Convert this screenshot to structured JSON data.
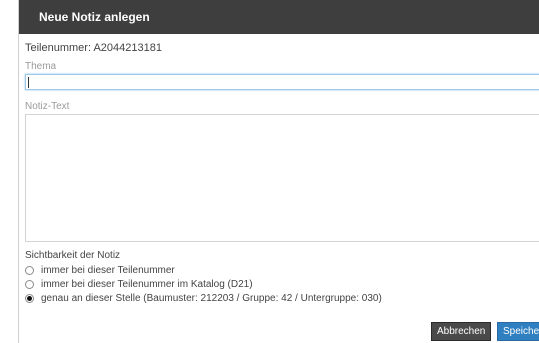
{
  "dialog": {
    "title": "Neue Notiz anlegen",
    "part_number": "Teilenummer: A2044213181",
    "thema_label": "Thema",
    "thema_value": "",
    "notiz_label": "Notiz-Text",
    "notiz_value": "",
    "visibility_label": "Sichtbarkeit der Notiz",
    "options": [
      {
        "label": "immer bei dieser Teilenummer",
        "selected": false
      },
      {
        "label": "immer bei dieser Teilenummer im Katalog (D21)",
        "selected": false
      },
      {
        "label": "genau an dieser Stelle (Baumuster: 212203 / Gruppe: 42 / Untergruppe: 030)",
        "selected": true
      }
    ],
    "buttons": {
      "cancel": "Abbrechen",
      "save": "Speichern"
    }
  },
  "colors": {
    "titlebar": "#3e3e3e",
    "save_button": "#2f7fc1",
    "cancel_button": "#4a4a4a",
    "focus_border": "#9ec8e6"
  }
}
